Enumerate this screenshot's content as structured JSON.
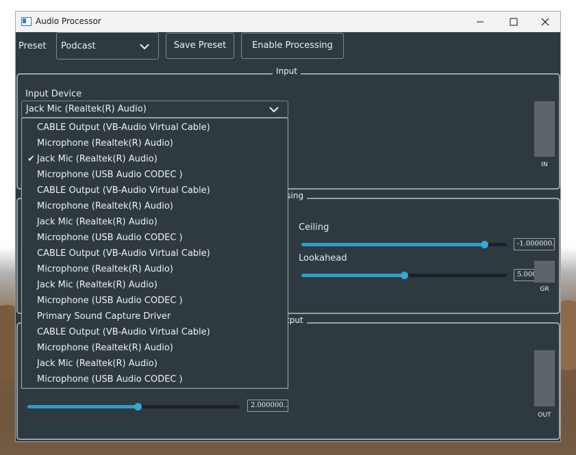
{
  "window": {
    "title": "Audio Processor"
  },
  "toolbar": {
    "preset_label": "Preset",
    "preset_value": "Podcast",
    "save_preset": "Save Preset",
    "enable_processing": "Enable Processing"
  },
  "input_group": {
    "title": "Input",
    "device_label": "Input Device",
    "device_value": "Jack Mic (Realtek(R) Audio)",
    "meter_label": "IN",
    "meter_level": 0
  },
  "processing_group": {
    "title_visible": "ssing",
    "ceiling_label": "Ceiling",
    "ceiling_value": "-1.000000...",
    "ceiling_position": 0.89,
    "lookahead_label": "Lookahead",
    "lookahead_value": "5.000000...",
    "lookahead_position": 0.5,
    "meter_label": "GR",
    "meter_level": 0
  },
  "output_group": {
    "title_visible": "tput",
    "gain_value": "2.000000...",
    "gain_position": 0.52,
    "meter_label": "OUT",
    "meter_level": 0
  },
  "dropdown": {
    "selected_index": 2,
    "items": [
      "CABLE Output (VB-Audio Virtual Cable)",
      "Microphone (Realtek(R) Audio)",
      "Jack Mic (Realtek(R) Audio)",
      "Microphone (USB Audio CODEC )",
      "CABLE Output (VB-Audio Virtual Cable)",
      "Microphone (Realtek(R) Audio)",
      "Jack Mic (Realtek(R) Audio)",
      "Microphone (USB Audio CODEC )",
      "CABLE Output (VB-Audio Virtual Cable)",
      "Microphone (Realtek(R) Audio)",
      "Jack Mic (Realtek(R) Audio)",
      "Microphone (USB Audio CODEC )",
      "Primary Sound Capture Driver",
      "CABLE Output (VB-Audio Virtual Cable)",
      "Microphone (Realtek(R) Audio)",
      "Jack Mic (Realtek(R) Audio)",
      "Microphone (USB Audio CODEC )"
    ]
  },
  "colors": {
    "window_bg": "#2e3a40",
    "accent": "#3aa6d6",
    "border": "#9aa3a8"
  }
}
